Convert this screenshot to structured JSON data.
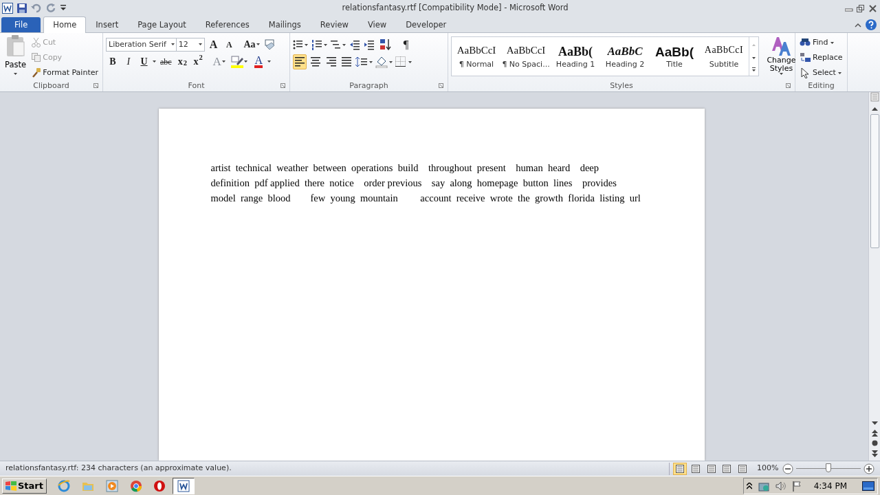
{
  "window": {
    "title": "relationsfantasy.rtf [Compatibility Mode]  -  Microsoft Word"
  },
  "tabs": [
    {
      "label": "File",
      "kind": "file",
      "selected": false
    },
    {
      "label": "Home",
      "kind": "tab",
      "selected": true
    },
    {
      "label": "Insert",
      "kind": "tab",
      "selected": false
    },
    {
      "label": "Page Layout",
      "kind": "tab",
      "selected": false
    },
    {
      "label": "References",
      "kind": "tab",
      "selected": false
    },
    {
      "label": "Mailings",
      "kind": "tab",
      "selected": false
    },
    {
      "label": "Review",
      "kind": "tab",
      "selected": false
    },
    {
      "label": "View",
      "kind": "tab",
      "selected": false
    },
    {
      "label": "Developer",
      "kind": "tab",
      "selected": false
    }
  ],
  "clipboard": {
    "label": "Clipboard",
    "paste": "Paste",
    "items": [
      {
        "label": "Cut",
        "disabled": true
      },
      {
        "label": "Copy",
        "disabled": true
      },
      {
        "label": "Format Painter",
        "disabled": false
      }
    ]
  },
  "font": {
    "label": "Font",
    "name": "Liberation Serif",
    "size": "12",
    "grow": "A",
    "shrink": "A",
    "change_case": "Aa",
    "buttons": [
      {
        "text": "B",
        "kind": "bold"
      },
      {
        "text": "I",
        "kind": "italic"
      },
      {
        "text": "U",
        "kind": "underline"
      },
      {
        "text": "abc",
        "kind": "strike"
      },
      {
        "text": "x$_{2}$",
        "kind": "sub"
      },
      {
        "text": "x$^{2}$",
        "kind": "sup"
      }
    ],
    "effects": "A",
    "font_color": "A"
  },
  "paragraph": {
    "label": "Paragraph",
    "show_marks": "¶",
    "alignments": [
      {
        "kind": "left",
        "selected": true
      },
      {
        "kind": "center",
        "selected": false
      },
      {
        "kind": "right",
        "selected": false
      },
      {
        "kind": "justify",
        "selected": false
      }
    ]
  },
  "styles": {
    "label": "Styles",
    "items": [
      {
        "preview": "AaBbCcI",
        "label": "¶ Normal",
        "kind": "normal"
      },
      {
        "preview": "AaBbCcI",
        "label": "¶ No Spaci...",
        "kind": "normal"
      },
      {
        "preview": "AaBb(",
        "label": "Heading 1",
        "kind": "heading1"
      },
      {
        "preview": "AaBbC",
        "label": "Heading 2",
        "kind": "heading2"
      },
      {
        "preview": "AaBb(",
        "label": "Title",
        "kind": "title"
      },
      {
        "preview": "AaBbCcI",
        "label": "Subtitle",
        "kind": "subtitle"
      }
    ],
    "change_styles": "Change Styles"
  },
  "editing": {
    "label": "Editing",
    "items": [
      {
        "label": "Find",
        "kind": "find"
      },
      {
        "label": "Replace",
        "kind": "replace"
      },
      {
        "label": "Select",
        "kind": "select"
      }
    ]
  },
  "document": {
    "lines": [
      "artist  technical  weather  between  operations  build    throughout  present    human  heard    deep",
      "definition  pdf applied  there  notice    order previous    say  along  homepage  button  lines    provides",
      "model  range  blood        few  young  mountain         account  receive  wrote  the  growth  florida  listing  url"
    ]
  },
  "status_bar": {
    "text": "relationsfantasy.rtf: 234 characters (an approximate value).",
    "views": [
      {
        "selected": true
      },
      {
        "selected": false
      },
      {
        "selected": false
      },
      {
        "selected": false
      },
      {
        "selected": false
      }
    ],
    "zoom": "100%",
    "zoom_slider": {
      "level": 0.5
    }
  },
  "taskbar": {
    "start": "Start",
    "apps": [
      {
        "kind": "ie",
        "selected": false
      },
      {
        "kind": "folder",
        "selected": false
      },
      {
        "kind": "media",
        "selected": false
      },
      {
        "kind": "chrome",
        "selected": false
      },
      {
        "kind": "opera",
        "selected": false
      },
      {
        "kind": "word",
        "selected": true
      }
    ],
    "clock": "4:34 PM"
  }
}
